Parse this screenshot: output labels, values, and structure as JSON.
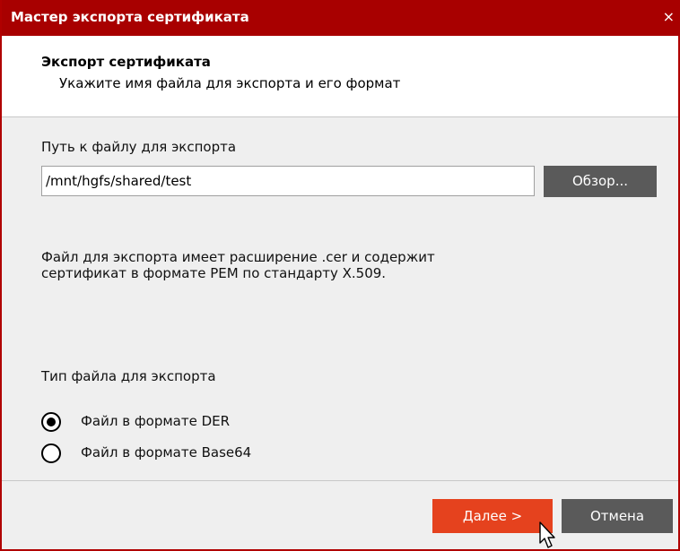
{
  "window": {
    "title": "Мастер экспорта сертификата",
    "close_glyph": "×"
  },
  "header": {
    "title": "Экспорт сертификата",
    "subtitle": "Укажите имя файла для экспорта и его формат"
  },
  "path": {
    "label": "Путь к файлу для экспорта",
    "value": "/mnt/hgfs/shared/test",
    "browse_label": "Обзор..."
  },
  "info": {
    "line1": "Файл для экспорта имеет расширение .cer и содержит",
    "line2": "сертификат в формате PEM по стандарту X.509."
  },
  "file_type": {
    "label": "Тип файла для экспорта",
    "options": [
      {
        "label": "Файл в формате DER",
        "selected": true
      },
      {
        "label": "Файл в формате Base64",
        "selected": false
      }
    ]
  },
  "footer": {
    "next_label": "Далее >",
    "cancel_label": "Отмена"
  },
  "colors": {
    "titlebar": "#a80000",
    "accent": "#e5421e",
    "button_dark": "#5a5a5a"
  }
}
